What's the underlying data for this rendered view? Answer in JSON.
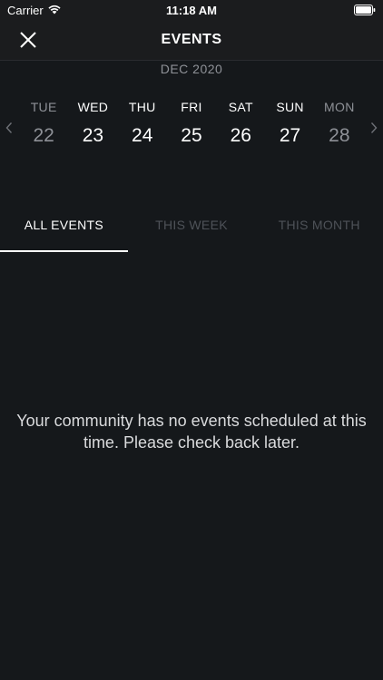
{
  "status_bar": {
    "carrier": "Carrier",
    "time": "11:18 AM"
  },
  "nav": {
    "title": "EVENTS"
  },
  "calendar": {
    "month": "DEC 2020",
    "days": [
      {
        "name": "TUE",
        "num": "22"
      },
      {
        "name": "WED",
        "num": "23"
      },
      {
        "name": "THU",
        "num": "24"
      },
      {
        "name": "FRI",
        "num": "25"
      },
      {
        "name": "SAT",
        "num": "26"
      },
      {
        "name": "SUN",
        "num": "27"
      },
      {
        "name": "MON",
        "num": "28"
      }
    ]
  },
  "tabs": [
    {
      "label": "ALL EVENTS"
    },
    {
      "label": "THIS WEEK"
    },
    {
      "label": "THIS MONTH"
    }
  ],
  "empty_state": {
    "message": "Your community has no events scheduled at this time. Please check back later."
  },
  "colors": {
    "background": "#15181b",
    "header": "#1b1c1e",
    "text_primary": "#ffffff",
    "text_muted": "#8e9197",
    "tab_inactive": "#4e5258"
  },
  "icons": {
    "close": "close-icon",
    "wifi": "wifi-icon",
    "battery": "battery-icon",
    "prev": "chevron-left-icon",
    "next": "chevron-right-icon"
  }
}
